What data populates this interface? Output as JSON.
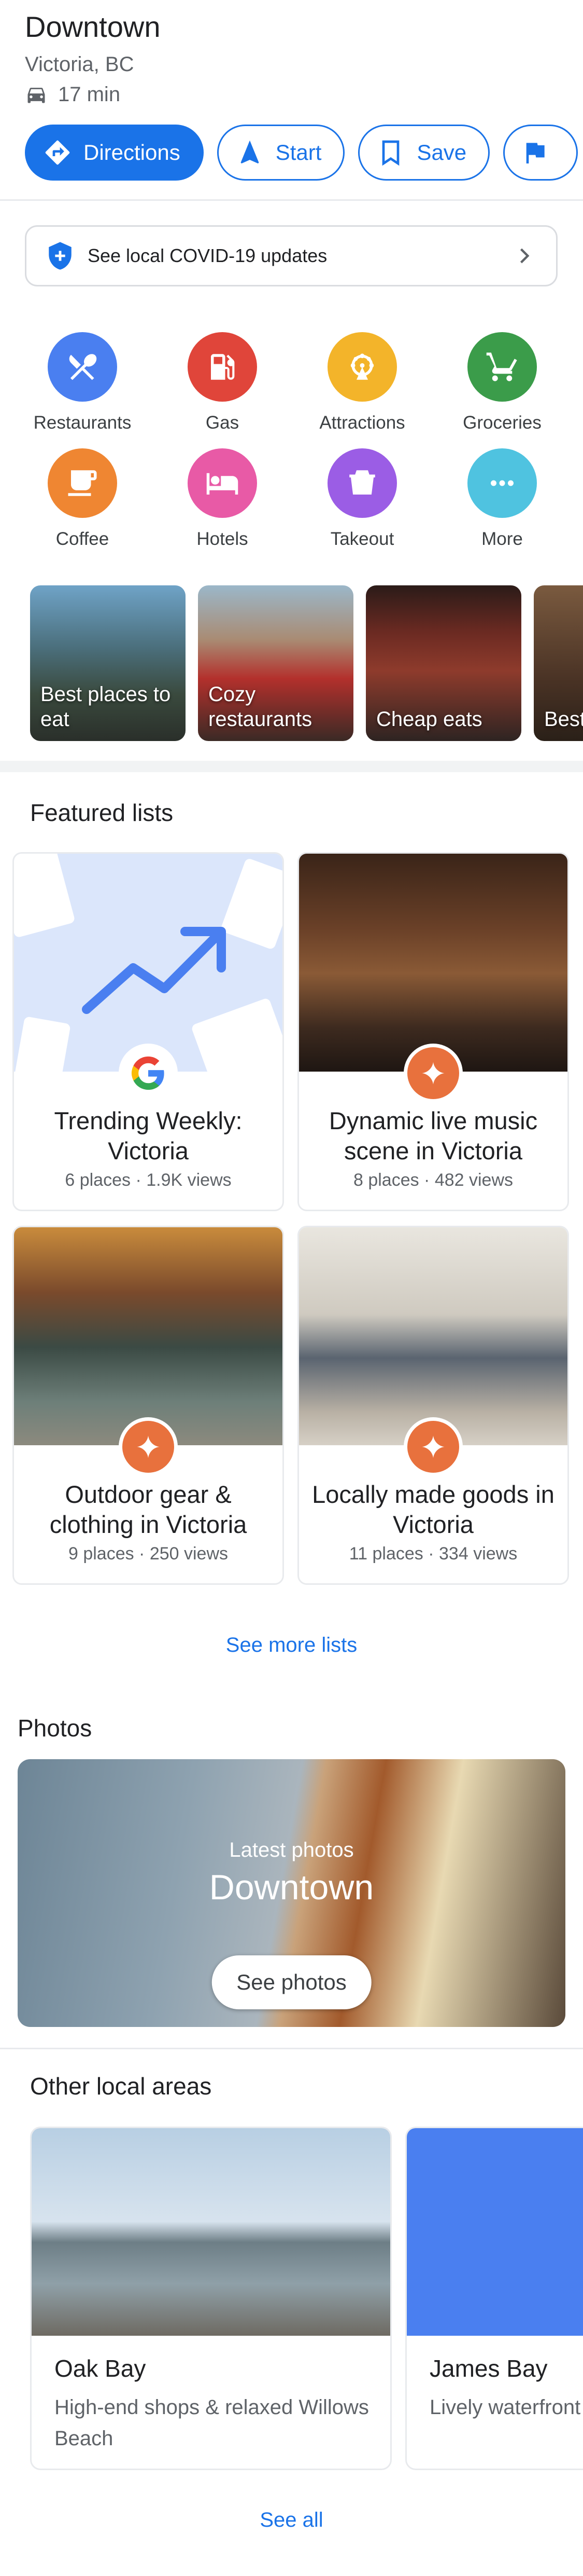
{
  "header": {
    "title": "Downtown",
    "subtitle": "Victoria, BC",
    "eta": "17 min",
    "eta_icon": "car-icon"
  },
  "actions": [
    {
      "label": "Directions",
      "icon": "directions-icon",
      "primary": true
    },
    {
      "label": "Start",
      "icon": "navigation-arrow-icon"
    },
    {
      "label": "Save",
      "icon": "bookmark-icon"
    },
    {
      "label": "",
      "icon": "flag-icon"
    }
  ],
  "covid": {
    "text": "See local COVID-19 updates",
    "icon": "shield-icon"
  },
  "categories": [
    {
      "label": "Restaurants",
      "icon": "fork-knife-icon",
      "color": "#4a7ff0"
    },
    {
      "label": "Gas",
      "icon": "gas-pump-icon",
      "color": "#e0453a"
    },
    {
      "label": "Attractions",
      "icon": "ferris-wheel-icon",
      "color": "#f3b42a"
    },
    {
      "label": "Groceries",
      "icon": "cart-icon",
      "color": "#3b9c4a"
    },
    {
      "label": "Coffee",
      "icon": "coffee-cup-icon",
      "color": "#ef8632"
    },
    {
      "label": "Hotels",
      "icon": "bed-icon",
      "color": "#e85aa6"
    },
    {
      "label": "Takeout",
      "icon": "takeout-bag-icon",
      "color": "#9b5de5"
    },
    {
      "label": "More",
      "icon": "more-dots-icon",
      "color": "#4fc3e0"
    }
  ],
  "explore": [
    {
      "label": "Best places to eat"
    },
    {
      "label": "Cozy restaurants"
    },
    {
      "label": "Cheap eats"
    },
    {
      "label": "Best with"
    }
  ],
  "featured": {
    "heading": "Featured lists",
    "items": [
      {
        "name": "Trending Weekly: Victoria",
        "meta": "6 places · 1.9K views",
        "badge": "google"
      },
      {
        "name": "Dynamic live music scene in Victoria",
        "meta": "8 places · 482 views",
        "badge": "star"
      },
      {
        "name": "Outdoor gear & clothing in Victoria",
        "meta": "9 places · 250 views",
        "badge": "star"
      },
      {
        "name": "Locally made goods in Victoria",
        "meta": "11 places · 334 views",
        "badge": "star"
      }
    ],
    "see_more": "See more lists"
  },
  "photos": {
    "heading": "Photos",
    "latest": "Latest photos",
    "place": "Downtown",
    "button": "See photos"
  },
  "areas": {
    "heading": "Other local areas",
    "items": [
      {
        "name": "Oak Bay",
        "desc": "High-end shops & relaxed Willows Beach"
      },
      {
        "name": "James Bay",
        "desc": "Lively waterfront Buildings"
      }
    ],
    "see_all": "See all"
  },
  "colors": {
    "accent": "#1a73e8",
    "badge_orange": "#e8713d"
  }
}
